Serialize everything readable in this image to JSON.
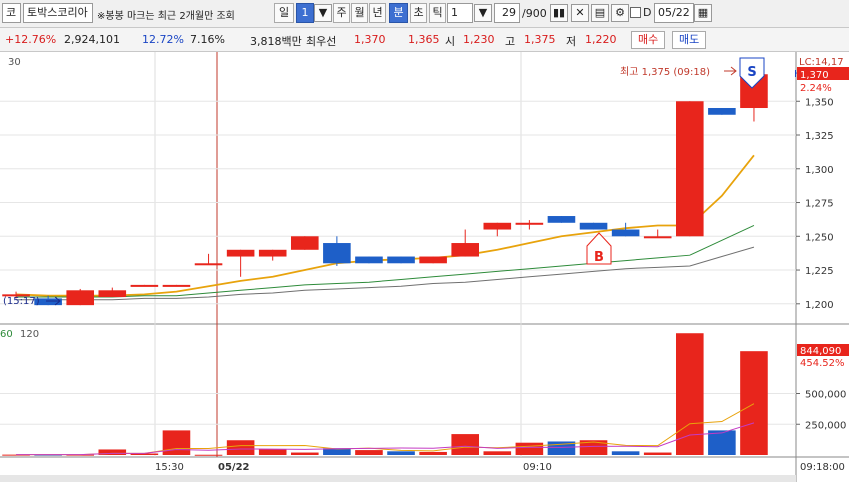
{
  "toolbar": {
    "market_code": "코",
    "stock_name": "토박스코리아",
    "notice": "※봉봉 마크는 최근 2개월만 조회",
    "period_day": "일",
    "period_value": "1",
    "period_week": "주",
    "period_month": "월",
    "period_year": "년",
    "period_minute": "분",
    "period_second": "초",
    "period_tick": "틱",
    "interval_value": "1",
    "count_current": "29",
    "count_total": "/900",
    "date_value": "05/22",
    "checkbox_label": "D"
  },
  "info": {
    "change_pct": "+12.76%",
    "volume": "2,924,101",
    "turnover_pct": "12.72%",
    "volume_pct": "7.16%",
    "trade_amount": "3,818백만",
    "best_bid_label": "최우선",
    "ask_price": "1,370",
    "bid_price": "1,365",
    "open_label": "시",
    "open_price": "1,230",
    "high_label": "고",
    "high_price": "1,375",
    "low_label": "저",
    "low_price": "1,220",
    "buy_label": "매수",
    "sell_label": "매도"
  },
  "chart": {
    "colors": {
      "up": "#e8251c",
      "down": "#1e5fc8",
      "ma_short": "#e8a30c",
      "ma_mid": "#2e8b3a",
      "ma_long": "#707070",
      "vol_ma_short": "#e8a30c",
      "vol_ma_long": "#c43bc4"
    },
    "price_panel_label": "30",
    "volume_panel_labels": [
      "60",
      "120"
    ],
    "lc_label": "LC:14,17",
    "h_label": "H",
    "current_price_tag": "1,370",
    "current_change_tag": "2.24%",
    "high_annotation": "최고 1,375 (09:18)",
    "low_annotation": "(15:17)",
    "buy_marker": "B",
    "sell_marker": "S",
    "volume_tag": "844,090",
    "volume_pct_tag": "454.52%",
    "time_tag": "09:18:00",
    "x_labels": [
      "15:30",
      "05/22",
      "09:10"
    ]
  },
  "chart_data": [
    {
      "type": "candlestick",
      "title": "",
      "y_ticks": [
        1200,
        1225,
        1250,
        1275,
        1300,
        1325,
        1350
      ],
      "ylim": [
        1188,
        1385
      ],
      "candles": [
        {
          "o": 1206,
          "h": 1209,
          "l": 1204,
          "c": 1207
        },
        {
          "o": 1204,
          "h": 1206,
          "l": 1199,
          "c": 1199
        },
        {
          "o": 1199,
          "h": 1211,
          "l": 1199,
          "c": 1210
        },
        {
          "o": 1205,
          "h": 1212,
          "l": 1205,
          "c": 1210
        },
        {
          "o": 1213,
          "h": 1214,
          "l": 1213,
          "c": 1214
        },
        {
          "o": 1213,
          "h": 1214,
          "l": 1213,
          "c": 1214
        },
        {
          "o": 1230,
          "h": 1237,
          "l": 1229,
          "c": 1230
        },
        {
          "o": 1235,
          "h": 1240,
          "l": 1220,
          "c": 1240
        },
        {
          "o": 1235,
          "h": 1240,
          "l": 1232,
          "c": 1240
        },
        {
          "o": 1240,
          "h": 1250,
          "l": 1240,
          "c": 1250
        },
        {
          "o": 1245,
          "h": 1250,
          "l": 1228,
          "c": 1230
        },
        {
          "o": 1235,
          "h": 1235,
          "l": 1230,
          "c": 1230
        },
        {
          "o": 1235,
          "h": 1235,
          "l": 1230,
          "c": 1230
        },
        {
          "o": 1230,
          "h": 1235,
          "l": 1230,
          "c": 1235
        },
        {
          "o": 1235,
          "h": 1255,
          "l": 1235,
          "c": 1245
        },
        {
          "o": 1255,
          "h": 1260,
          "l": 1250,
          "c": 1260
        },
        {
          "o": 1260,
          "h": 1262,
          "l": 1255,
          "c": 1260
        },
        {
          "o": 1265,
          "h": 1265,
          "l": 1260,
          "c": 1260
        },
        {
          "o": 1260,
          "h": 1260,
          "l": 1255,
          "c": 1255
        },
        {
          "o": 1255,
          "h": 1260,
          "l": 1250,
          "c": 1250
        },
        {
          "o": 1250,
          "h": 1255,
          "l": 1249,
          "c": 1250
        },
        {
          "o": 1250,
          "h": 1350,
          "l": 1250,
          "c": 1350
        },
        {
          "o": 1345,
          "h": 1345,
          "l": 1340,
          "c": 1340
        },
        {
          "o": 1345,
          "h": 1375,
          "l": 1335,
          "c": 1370
        }
      ],
      "moving_averages": [
        {
          "name": "30",
          "values": [
            1207,
            1206,
            1206,
            1206,
            1207,
            1209,
            1213,
            1217,
            1220,
            1225,
            1230,
            1232,
            1233,
            1234,
            1236,
            1240,
            1245,
            1250,
            1253,
            1256,
            1258,
            1258,
            1280,
            1310
          ]
        },
        {
          "name": "60",
          "values": [
            1205,
            1205,
            1205,
            1205,
            1206,
            1206,
            1208,
            1210,
            1212,
            1214,
            1215,
            1216,
            1218,
            1220,
            1222,
            1224,
            1226,
            1228,
            1230,
            1232,
            1234,
            1236,
            1247,
            1258
          ]
        },
        {
          "name": "120",
          "values": [
            1203,
            1203,
            1203,
            1203,
            1204,
            1204,
            1205,
            1207,
            1208,
            1210,
            1211,
            1212,
            1213,
            1215,
            1216,
            1218,
            1220,
            1222,
            1224,
            1226,
            1227,
            1228,
            1235,
            1242
          ]
        }
      ]
    },
    {
      "type": "bar",
      "title": "",
      "y_ticks": [
        250000,
        500000
      ],
      "ylim": [
        0,
        1000000
      ],
      "values": [
        3000,
        3000,
        3000,
        45000,
        12000,
        200000,
        2000,
        120000,
        45000,
        20000,
        55000,
        40000,
        30000,
        25000,
        170000,
        30000,
        100000,
        110000,
        120000,
        30000,
        20000,
        990000,
        200000,
        844090
      ],
      "directions": [
        "up",
        "down",
        "up",
        "up",
        "up",
        "up",
        "up",
        "up",
        "up",
        "up",
        "down",
        "up",
        "down",
        "up",
        "up",
        "up",
        "up",
        "down",
        "up",
        "down",
        "up",
        "up",
        "down",
        "up"
      ]
    }
  ]
}
